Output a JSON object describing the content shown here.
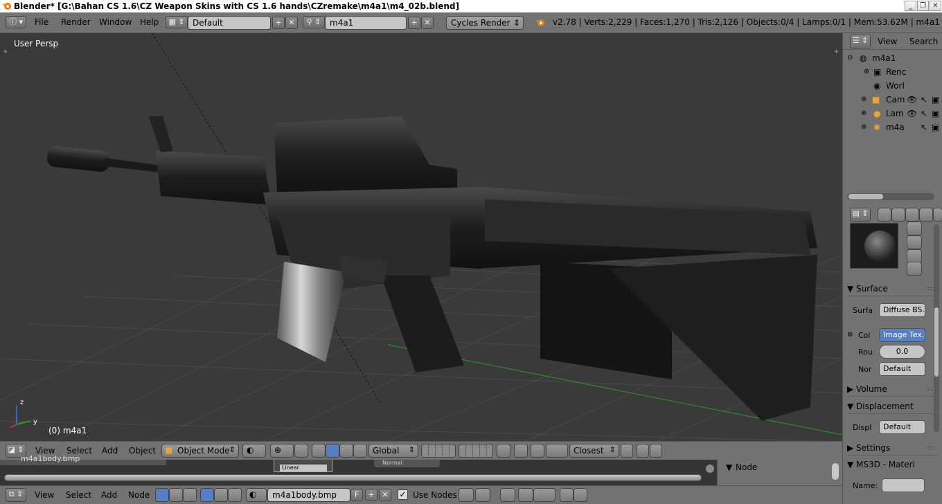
{
  "titlebar": {
    "title": "Blender* [G:\\Bahan CS 1.6\\CZ Weapon Skins with CS 1.6 hands\\CZremake\\m4a1\\m4_02b.blend]",
    "controls": [
      "_",
      "❐",
      "✕"
    ]
  },
  "infobar": {
    "menus": [
      "File",
      "Render",
      "Window",
      "Help"
    ],
    "screen_layout": "Default",
    "scene": "m4a1",
    "render_engine": "Cycles Render",
    "stats": "v2.78 | Verts:2,229 | Faces:1,270 | Tris:2,126 | Objects:0/4 | Lamps:0/1 | Mem:53.62M | m4a1"
  },
  "viewport": {
    "view_name": "User Persp",
    "object_label": "(0) m4a1",
    "axis_labels": [
      "z",
      "y"
    ]
  },
  "viewport_header": {
    "menus": [
      "View",
      "Select",
      "Add",
      "Object"
    ],
    "mode": "Object Mode",
    "orientation": "Global",
    "snap_target": "Closest"
  },
  "node_editor": {
    "texture_label": "m4a1body.bmp",
    "node_labels": [
      "Linear",
      "Normal"
    ],
    "sidebar_title": "Node"
  },
  "node_header": {
    "menus": [
      "View",
      "Select",
      "Add",
      "Node"
    ],
    "image_name": "m4a1body.bmp",
    "fake_user": "F",
    "use_nodes_label": "Use Nodes"
  },
  "outliner": {
    "header_menus": [
      "View",
      "Search"
    ],
    "items": [
      {
        "label": "m4a1",
        "icon": "scene-icon",
        "depth": 0
      },
      {
        "label": "Renc",
        "icon": "render-layers-icon",
        "depth": 1
      },
      {
        "label": "Worl",
        "icon": "world-icon",
        "depth": 1
      },
      {
        "label": "Cam",
        "icon": "camera-icon",
        "depth": 1
      },
      {
        "label": "Lam",
        "icon": "lamp-icon",
        "depth": 1
      },
      {
        "label": "m4a",
        "icon": "armature-icon",
        "depth": 1
      }
    ]
  },
  "properties": {
    "sections": {
      "surface": "Surface",
      "volume": "Volume",
      "displacement": "Displacement",
      "settings": "Settings",
      "material_panel": "MS3D - Materi"
    },
    "fields": {
      "surface_label": "Surfa",
      "surface_value": "Diffuse BS...",
      "color_label": "Col",
      "color_value": "Image Tex...",
      "roughness_label": "Rou",
      "roughness_value": "0.0",
      "normal_label": "Nor",
      "normal_value": "Default",
      "displacement_label": "Displ",
      "displacement_value": "Default",
      "name_label": "Name:"
    }
  },
  "colors": {
    "panel": "#727272",
    "viewport_bg": "#3a3a3a",
    "accent_blue": "#5680c2",
    "grid_green": "#2e8b2e"
  }
}
